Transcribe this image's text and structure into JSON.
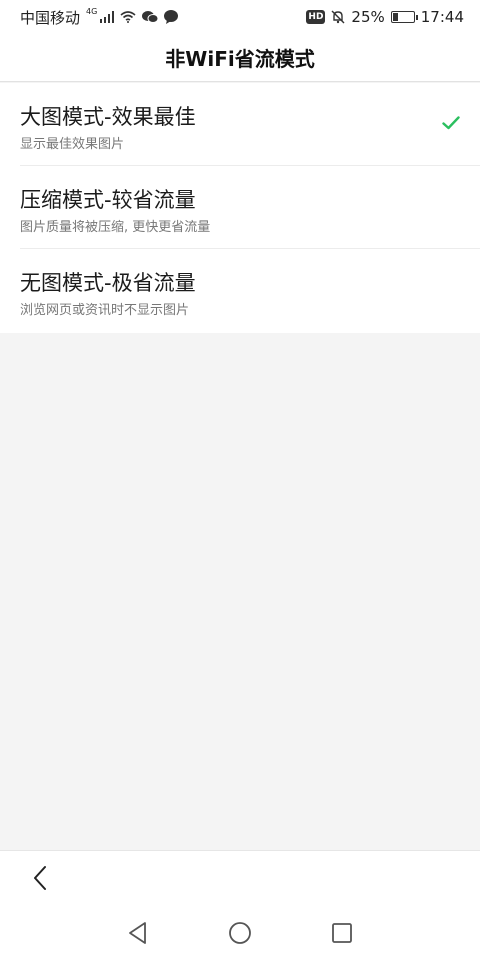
{
  "status_bar": {
    "carrier": "中国移动",
    "network": "4G",
    "battery": "25%",
    "battery_level": 0.25,
    "time": "17:44",
    "hd": "HD"
  },
  "header": {
    "title": "非WiFi省流模式"
  },
  "options": [
    {
      "title": "大图模式-效果最佳",
      "desc": "显示最佳效果图片",
      "selected": true
    },
    {
      "title": "压缩模式-较省流量",
      "desc": "图片质量将被压缩, 更快更省流量",
      "selected": false
    },
    {
      "title": "无图模式-极省流量",
      "desc": "浏览网页或资讯时不显示图片",
      "selected": false
    }
  ],
  "colors": {
    "check": "#2bbf5f",
    "background": "#f4f4f4"
  },
  "icons": {
    "check": "check-icon",
    "back": "chevron-left-icon",
    "nav_back": "triangle-back-icon",
    "nav_home": "circle-home-icon",
    "nav_recent": "square-recent-icon"
  }
}
